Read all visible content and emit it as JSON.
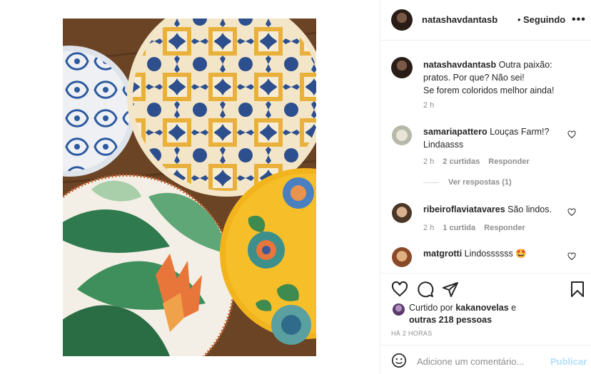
{
  "post": {
    "username": "natashavdantasb",
    "dot": "•",
    "follow_status": "Seguindo"
  },
  "caption": {
    "username": "natashavdantasb",
    "line1": " Outra paixão:",
    "line2": "pratos. Por que? Não sei!",
    "line3": "Se forem coloridos melhor ainda!",
    "time": "2 h"
  },
  "comments": [
    {
      "username": "samariapattero",
      "text_a": " Louças Farm!?",
      "text_b": "Lindaasss",
      "time": "2 h",
      "likes": "2 curtidas",
      "reply": "Responder",
      "view_replies": "Ver respostas (1)"
    },
    {
      "username": "ribeiroflaviatavares",
      "text_a": " São lindos.",
      "time": "2 h",
      "likes": "1 curtida",
      "reply": "Responder"
    },
    {
      "username": "matgrotti",
      "text_a": " Lindossssss 🤩"
    }
  ],
  "liked": {
    "prefix": "Curtido por ",
    "user": "kakanovelas",
    "mid": " e",
    "others": "outras 218 pessoas"
  },
  "timestamp": "HÁ 2 HORAS",
  "add_comment": {
    "placeholder": "Adicione um comentário...",
    "post_label": "Publicar"
  },
  "colors": {
    "link_disabled": "#b2dffc",
    "secondary": "#8e8e8e",
    "primary": "#262626"
  }
}
